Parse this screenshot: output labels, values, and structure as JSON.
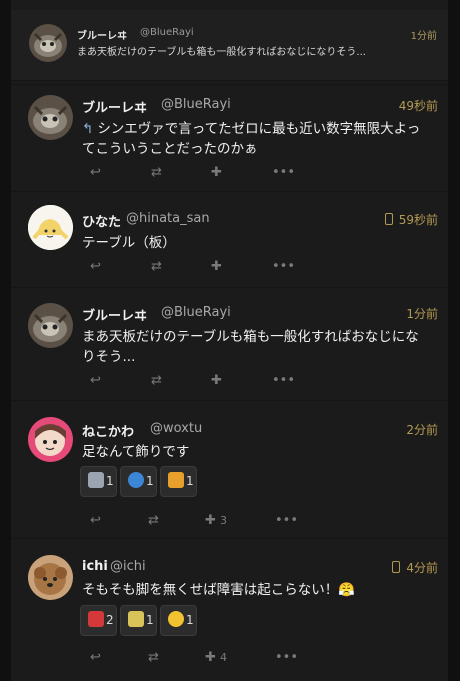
{
  "notification": {
    "name": "ブルーレヰ",
    "handle": "@BlueRayi",
    "time": "1分前",
    "text": "まあ天板だけのテーブルも箱も一般化すればおなじになりそう..."
  },
  "notes": [
    {
      "name": "ブルーレヰ",
      "handle": "@BlueRayi",
      "time": "49秒前",
      "reply_icon": "reply-arrow-icon",
      "text": "シンエヴァで言ってたゼロに最も近い数字無限大よってこういうことだったのかぁ",
      "plus_count": ""
    },
    {
      "name": "ひなた",
      "handle": "@hinata_san",
      "time": "59秒前",
      "text": "テーブル（板）",
      "plus_count": ""
    },
    {
      "name": "ブルーレヰ",
      "handle": "@BlueRayi",
      "time": "1分前",
      "text": "まあ天板だけのテーブルも箱も一般化すればおなじになりそう...",
      "plus_count": ""
    },
    {
      "name": "ねこかわ",
      "handle": "@woxtu",
      "time": "2分前",
      "text": "足なんて飾りです",
      "reactions": [
        "1",
        "1",
        "1"
      ],
      "plus_count": "3"
    },
    {
      "name": "ichi",
      "handle": "@ichi",
      "time": "4分前",
      "text": "そもそも脚を無くせば障害は起こらない！😤",
      "reactions": [
        "2",
        "1",
        "1"
      ],
      "plus_count": "4"
    }
  ],
  "action_icons": [
    "reply-icon",
    "renote-icon",
    "plus-icon",
    "more-icon"
  ]
}
